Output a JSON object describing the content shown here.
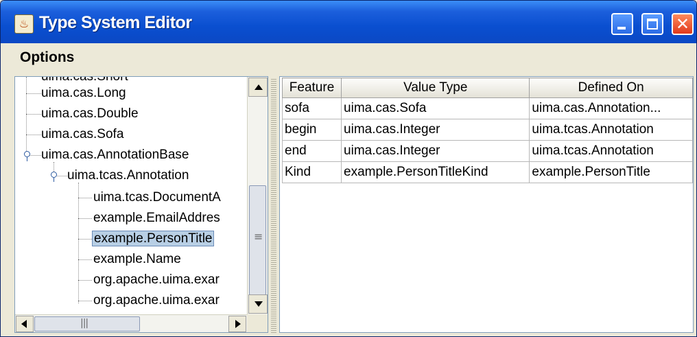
{
  "window": {
    "title": "Type System Editor",
    "controls": [
      "minimize",
      "maximize",
      "close"
    ]
  },
  "menu": {
    "options_label": "Options"
  },
  "tree": {
    "nodes": [
      "uima.cas.Short",
      "uima.cas.Long",
      "uima.cas.Double",
      "uima.cas.Sofa",
      "uima.cas.AnnotationBase",
      "uima.tcas.Annotation",
      "uima.tcas.DocumentA",
      "example.EmailAddres",
      "example.PersonTitle",
      "example.Name",
      "org.apache.uima.exar",
      "org.apache.uima.exar"
    ],
    "selected": "example.PersonTitle"
  },
  "table": {
    "columns": [
      "Feature",
      "Value Type",
      "Defined On"
    ],
    "rows": [
      [
        "sofa",
        "uima.cas.Sofa",
        "uima.cas.Annotation..."
      ],
      [
        "begin",
        "uima.cas.Integer",
        "uima.tcas.Annotation"
      ],
      [
        "end",
        "uima.cas.Integer",
        "uima.tcas.Annotation"
      ],
      [
        "Kind",
        "example.PersonTitleKind",
        "example.PersonTitle"
      ]
    ]
  },
  "icons": {
    "app": "java-cup-icon",
    "close_glyph": "✕"
  },
  "colors": {
    "titlebar": "#0b48c4",
    "selection": "#b8cfe5"
  }
}
